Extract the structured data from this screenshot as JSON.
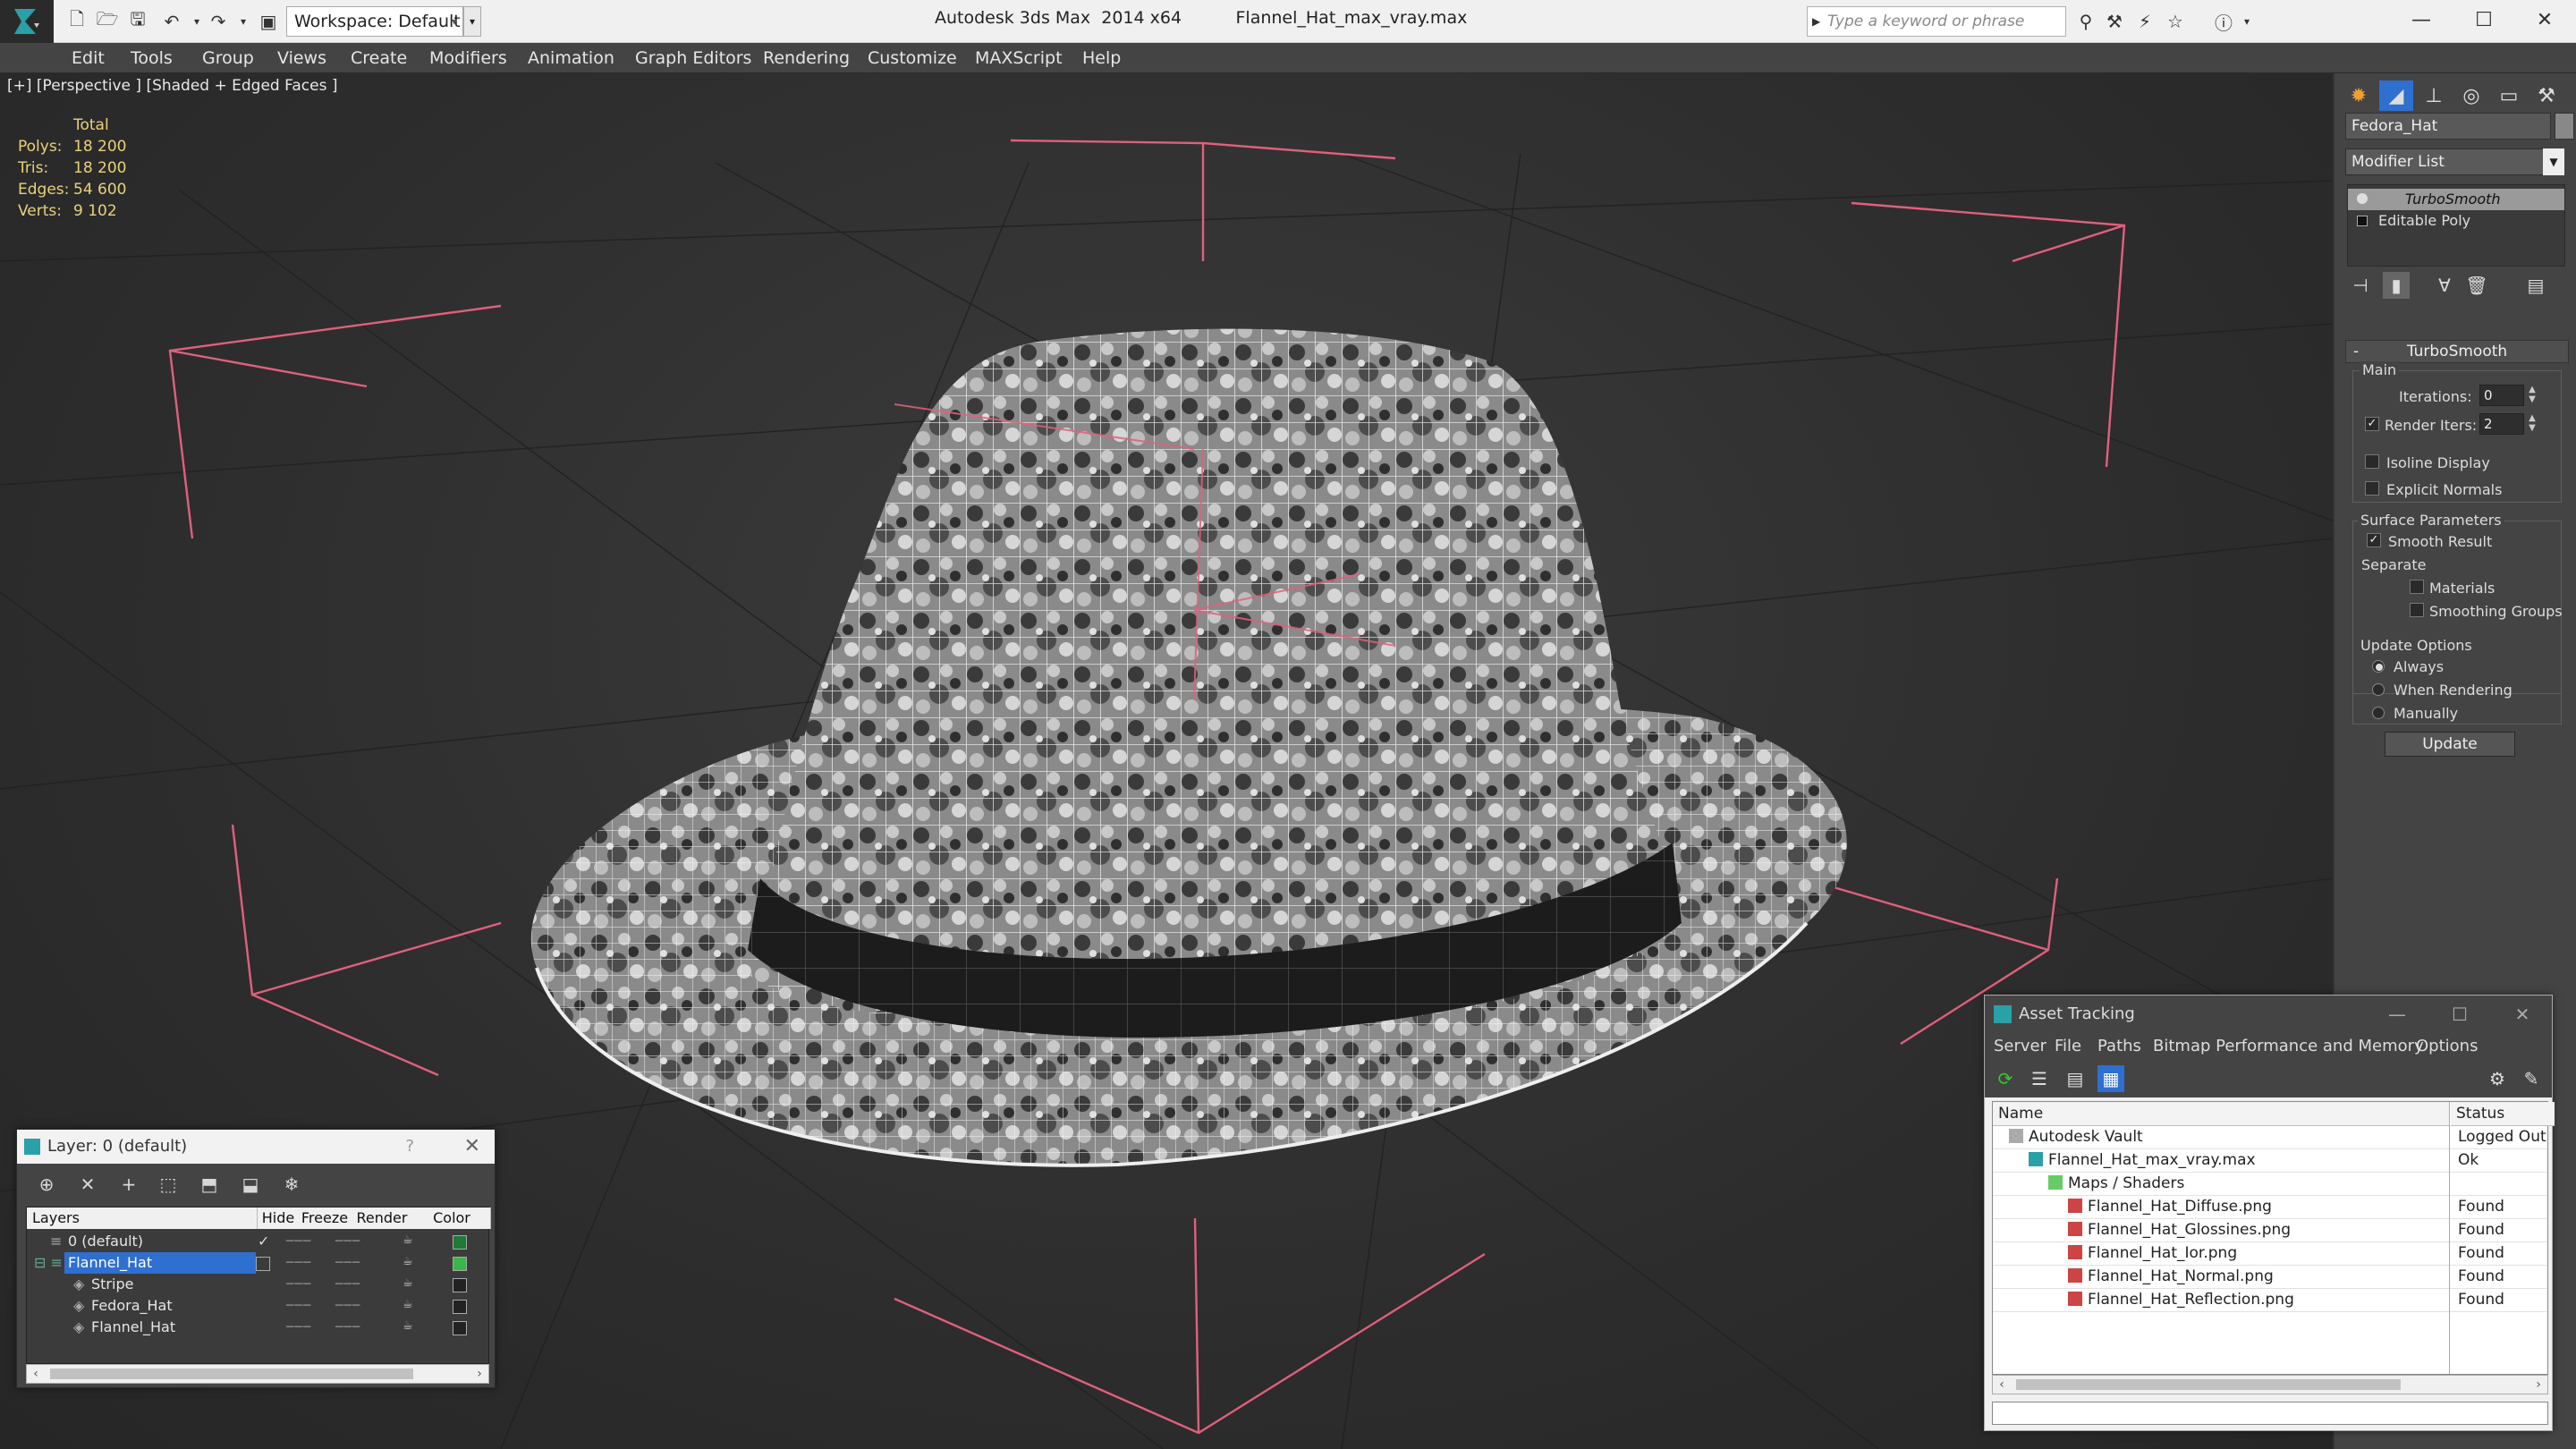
{
  "app": {
    "title": "Autodesk 3ds Max  2014 x64",
    "file": "Flannel_Hat_max_vray.max",
    "workspace": "Workspace: Default",
    "search_placeholder": "Type a keyword or phrase"
  },
  "menu": [
    "Edit",
    "Tools",
    "Group",
    "Views",
    "Create",
    "Modifiers",
    "Animation",
    "Graph Editors",
    "Rendering",
    "Customize",
    "MAXScript",
    "Help"
  ],
  "viewport": {
    "label": "[+] [Perspective ] [Shaded + Edged Faces ]",
    "stats_header": "Total",
    "stats": [
      {
        "key": "Polys:",
        "value": "18 200"
      },
      {
        "key": "Tris:",
        "value": "18 200"
      },
      {
        "key": "Edges:",
        "value": "54 600"
      },
      {
        "key": "Verts:",
        "value": "9 102"
      }
    ]
  },
  "command_panel": {
    "object_name": "Fedora_Hat",
    "modifier_list": "Modifier List",
    "stack": [
      "TurboSmooth",
      "Editable Poly"
    ],
    "rollout_title": "TurboSmooth",
    "main_group": "Main",
    "iterations_label": "Iterations:",
    "iterations_value": "0",
    "render_iters_label": "Render Iters:",
    "render_iters_value": "2",
    "isoline_display": "Isoline Display",
    "explicit_normals": "Explicit Normals",
    "surface_params": "Surface Parameters",
    "smooth_result": "Smooth Result",
    "separate": "Separate",
    "materials": "Materials",
    "smoothing_groups": "Smoothing Groups",
    "update_options": "Update Options",
    "always": "Always",
    "when_rendering": "When Rendering",
    "manually": "Manually",
    "update_button": "Update"
  },
  "layer_window": {
    "title": "Layer: 0 (default)",
    "help": "?",
    "columns": [
      "Layers",
      "Hide",
      "Freeze",
      "Render",
      "Color"
    ],
    "rows": [
      {
        "name": "0 (default)",
        "indent": 0,
        "color": "#1f7a3a"
      },
      {
        "name": "Flannel_Hat",
        "indent": 0,
        "color": "#39b54a"
      },
      {
        "name": "Stripe",
        "indent": 1,
        "color": "#222222"
      },
      {
        "name": "Fedora_Hat",
        "indent": 1,
        "color": "#222222"
      },
      {
        "name": "Flannel_Hat",
        "indent": 1,
        "color": "#222222"
      }
    ]
  },
  "asset_tracking": {
    "title": "Asset Tracking",
    "menu": [
      "Server",
      "File",
      "Paths",
      "Bitmap Performance and Memory",
      "Options"
    ],
    "columns": [
      "Name",
      "Status"
    ],
    "rows": [
      {
        "name": "Autodesk Vault",
        "status": "Logged Out",
        "level": 0,
        "icon": "vault"
      },
      {
        "name": "Flannel_Hat_max_vray.max",
        "status": "Ok",
        "level": 1,
        "icon": "max"
      },
      {
        "name": "Maps / Shaders",
        "status": "",
        "level": 2,
        "icon": "folder"
      },
      {
        "name": "Flannel_Hat_Diffuse.png",
        "status": "Found",
        "level": 3,
        "icon": "png"
      },
      {
        "name": "Flannel_Hat_Glossines.png",
        "status": "Found",
        "level": 3,
        "icon": "png"
      },
      {
        "name": "Flannel_Hat_Ior.png",
        "status": "Found",
        "level": 3,
        "icon": "png"
      },
      {
        "name": "Flannel_Hat_Normal.png",
        "status": "Found",
        "level": 3,
        "icon": "png"
      },
      {
        "name": "Flannel_Hat_Reflection.png",
        "status": "Found",
        "level": 3,
        "icon": "png"
      }
    ]
  }
}
